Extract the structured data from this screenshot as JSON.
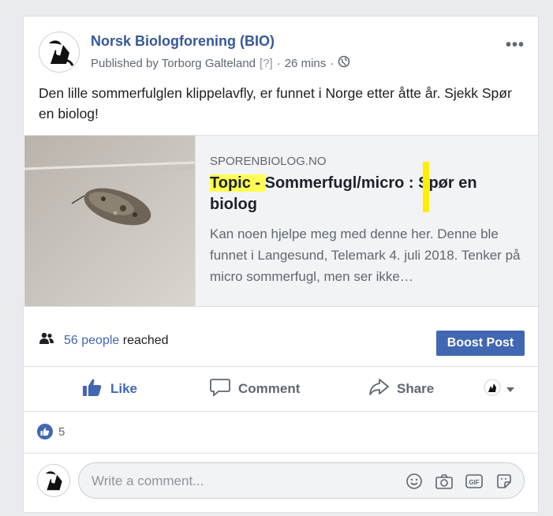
{
  "post": {
    "page_name": "Norsk Biologforening (BIO)",
    "published_by": "Published by Torborg Galteland",
    "question_mark": "[?]",
    "separator": "·",
    "time": "26 mins",
    "message": "Den lille sommerfulglen klippelavfly, er funnet i Norge etter åtte år. Sjekk Spør en biolog!"
  },
  "link_preview": {
    "domain": "SPORENBIOLOG.NO",
    "title_highlight": "Topic - ",
    "title_rest": "Sommerfugl/micro : Spør en biolog",
    "description": "Kan noen hjelpe meg med denne her. Denne ble funnet i Langesund, Telemark 4. juli 2018. Tenker på micro sommerfugl, men ser ikke…"
  },
  "insights": {
    "reach_count": "56 people",
    "reach_label": "reached",
    "boost_label": "Boost Post"
  },
  "actions": {
    "like": "Like",
    "comment": "Comment",
    "share": "Share"
  },
  "reactions": {
    "count": "5"
  },
  "comment_box": {
    "placeholder": "Write a comment..."
  },
  "colors": {
    "brand_blue": "#4267b2",
    "link_blue": "#365899",
    "highlight": "#ffff55"
  },
  "icons": [
    "more-options-icon",
    "globe-icon",
    "people-icon",
    "like-thumb-icon",
    "comment-bubble-icon",
    "share-arrow-icon",
    "caret-down-icon",
    "emoji-icon",
    "camera-icon",
    "gif-icon",
    "sticker-icon"
  ]
}
